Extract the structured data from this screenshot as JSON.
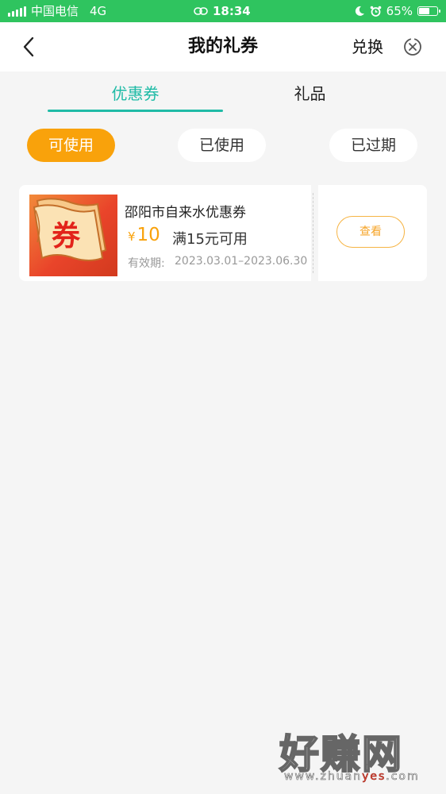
{
  "status_bar": {
    "carrier": "中国电信",
    "network": "4G",
    "time": "18:34",
    "battery": "65%",
    "battery_level": 0.65,
    "icons": [
      "signal-icon",
      "link-icon",
      "moon-icon",
      "alarm-icon",
      "battery-icon"
    ]
  },
  "nav": {
    "title": "我的礼券",
    "redeem_label": "兑换",
    "icons": [
      "back-icon",
      "close-circle-icon"
    ]
  },
  "tabs": [
    {
      "label": "优惠券",
      "active": true
    },
    {
      "label": "礼品",
      "active": false
    }
  ],
  "filters": [
    {
      "label": "可使用",
      "active": true
    },
    {
      "label": "已使用",
      "active": false
    },
    {
      "label": "已过期",
      "active": false
    }
  ],
  "coupon": {
    "name": "邵阳市自来水优惠券",
    "currency": "¥",
    "amount": "10",
    "condition": "满15元可用",
    "validity_label": "有效期:",
    "validity": "2023.03.01–2023.06.30",
    "image_text": "券",
    "view_label": "查看"
  },
  "watermark": {
    "text": "好赚网",
    "url_prefix": "www.zhuan",
    "url_accent": "yes",
    "url_suffix": ".com"
  },
  "colors": {
    "status_bar": "#2fc45f",
    "accent_teal": "#1fbba6",
    "accent_orange": "#f9a20b",
    "background": "#f5f5f5"
  }
}
